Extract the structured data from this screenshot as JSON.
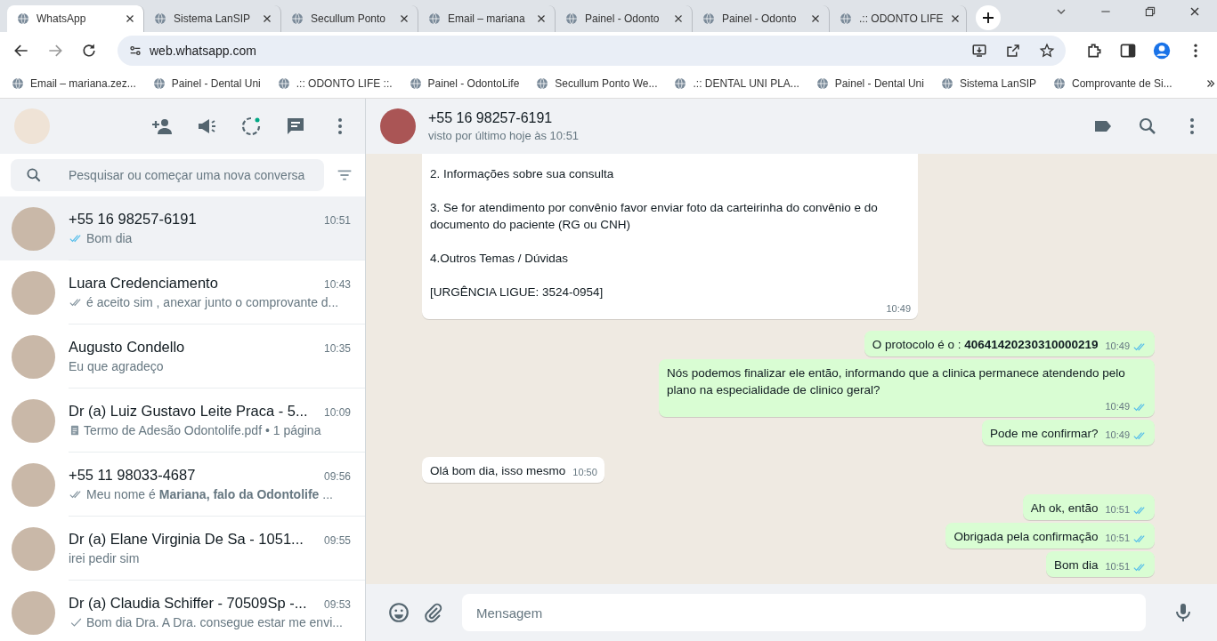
{
  "browser": {
    "tabs": [
      {
        "title": "WhatsApp",
        "selected": true
      },
      {
        "title": "Sistema LanSIP",
        "selected": false
      },
      {
        "title": "Secullum Ponto",
        "selected": false
      },
      {
        "title": "Email – mariana",
        "selected": false
      },
      {
        "title": "Painel - Odonto",
        "selected": false
      },
      {
        "title": "Painel - Odonto",
        "selected": false
      },
      {
        "title": ".:: ODONTO LIFE",
        "selected": false
      }
    ],
    "url": "web.whatsapp.com",
    "bookmarks": [
      "Email – mariana.zez...",
      "Painel - Dental Uni",
      ".:: ODONTO LIFE ::.",
      "Painel - OdontoLife",
      "Secullum Ponto We...",
      ".:: DENTAL UNI PLA...",
      "Painel - Dental Uni",
      "Sistema LanSIP",
      "Comprovante de Si..."
    ]
  },
  "sidebar": {
    "search": {
      "placeholder": "Pesquisar ou começar uma nova conversa"
    },
    "chats": [
      {
        "name": "+55 16 98257-6191",
        "time": "10:51",
        "preview": "Bom dia",
        "kind": "double",
        "read": true,
        "selected": true
      },
      {
        "name": "Luara Credenciamento",
        "time": "10:43",
        "preview": "é aceito sim , anexar junto o comprovante d...",
        "kind": "double",
        "read": false,
        "selected": false
      },
      {
        "name": "Augusto Condello",
        "time": "10:35",
        "preview": "Eu que agradeço",
        "kind": "plain",
        "selected": false
      },
      {
        "name": "Dr (a) Luiz Gustavo Leite Praca - 5...",
        "time": "10:09",
        "preview": "Termo de Adesão Odontolife.pdf • 1 página",
        "kind": "document",
        "selected": false
      },
      {
        "name": "+55 11 98033-4687",
        "time": "09:56",
        "preview": "Meu nome é **Mariana, falo da Odontolife** ...",
        "kind": "double",
        "read": false,
        "selected": false
      },
      {
        "name": "Dr (a) Elane Virginia De Sa - 1051...",
        "time": "09:55",
        "preview": "irei pedir sim",
        "kind": "plain",
        "selected": false
      },
      {
        "name": "Dr (a) Claudia Schiffer - 70509Sp -...",
        "time": "09:53",
        "preview": "Bom dia Dra.  A Dra. consegue estar me envi...",
        "kind": "single",
        "read": false,
        "selected": false
      }
    ]
  },
  "conversation": {
    "contact": "+55 16 98257-6191",
    "last_seen": "visto por último hoje às 10:51",
    "messages": [
      {
        "outgoing": false,
        "paragraphs": [
          "2. Informações sobre sua consulta",
          "3. Se for atendimento por convênio favor enviar foto da carteirinha do convênio e do documento do paciente (RG ou CNH)",
          "4.Outros Temas / Dúvidas",
          "[URGÊNCIA LIGUE: 3524-0954]"
        ],
        "time": "10:49"
      },
      {
        "outgoing": true,
        "paragraphs": [
          "O protocolo é o : **40641420230310000219**"
        ],
        "time": "10:49",
        "read": true
      },
      {
        "outgoing": true,
        "paragraphs": [
          "Nós podemos finalizar ele então, informando que a clinica permanece atendendo pelo plano na especialidade de clinico geral?"
        ],
        "time": "10:49",
        "read": true
      },
      {
        "outgoing": true,
        "paragraphs": [
          "Pode me confirmar?"
        ],
        "time": "10:49",
        "read": true
      },
      {
        "outgoing": false,
        "paragraphs": [
          "Olá bom dia, isso mesmo"
        ],
        "time": "10:50"
      },
      {
        "outgoing": true,
        "paragraphs": [
          "Ah ok, então"
        ],
        "time": "10:51",
        "read": true
      },
      {
        "outgoing": true,
        "paragraphs": [
          "Obrigada pela confirmação"
        ],
        "time": "10:51",
        "read": true
      },
      {
        "outgoing": true,
        "paragraphs": [
          "Bom dia"
        ],
        "time": "10:51",
        "read": true
      }
    ],
    "composer": {
      "placeholder": "Mensagem"
    }
  }
}
